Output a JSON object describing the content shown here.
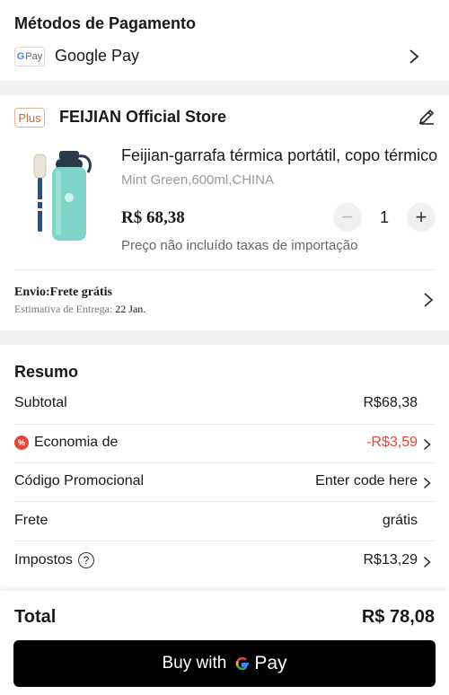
{
  "payment": {
    "title": "Métodos de Pagamento",
    "badge_text": "Pay",
    "badge_g": "G",
    "method": "Google Pay"
  },
  "store": {
    "plus_badge": "Plus",
    "name": "FEIJIAN Official Store",
    "product": {
      "title": "Feijian-garrafa térmica portátil, copo térmico",
      "variant": "Mint Green,600ml,CHINA",
      "price": "R$ 68,38",
      "quantity": "1",
      "minus": "−",
      "plus": "+",
      "import_note": "Preço não incluído taxas de importação",
      "colors": {
        "bottle": "#7fd6c8",
        "cap": "#2b3a4a",
        "brush": "#2c4f76"
      }
    },
    "shipping": {
      "title": "Envio:Frete grátis",
      "delivery_label": "Estimativa de Entrega:",
      "delivery_date": "22 Jan."
    }
  },
  "summary": {
    "title": "Resumo",
    "subtotal_label": "Subtotal",
    "subtotal_value": "R$68,38",
    "savings_icon": "%",
    "savings_label": "Economia de",
    "savings_value": "-R$3,59",
    "promo_label": "Código Promocional",
    "promo_placeholder": "Enter code here",
    "shipping_label": "Frete",
    "shipping_value": "grátis",
    "taxes_label": "Impostos",
    "taxes_help": "?",
    "taxes_value": "R$13,29"
  },
  "footer": {
    "total_label": "Total",
    "total_value": "R$ 78,08",
    "buy_prefix": "Buy with",
    "buy_pay": "Pay"
  },
  "colors": {
    "accent_red": "#e5463a",
    "plus_badge": "#c8683a",
    "button_bg": "#000000"
  }
}
